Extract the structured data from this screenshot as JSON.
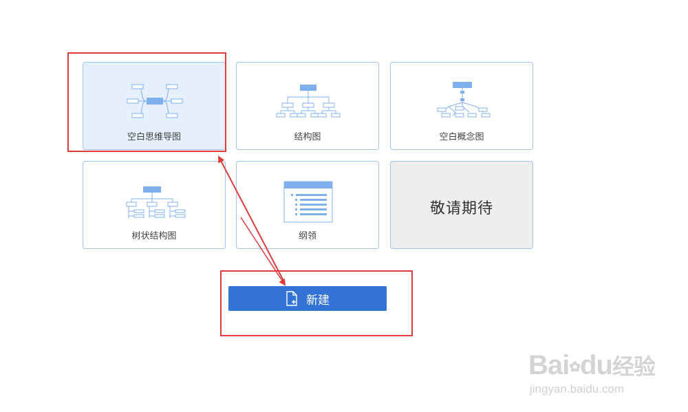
{
  "templates": [
    {
      "label": "空白思维导图",
      "icon": "mindmap-icon",
      "selected": true
    },
    {
      "label": "结构图",
      "icon": "org-chart-icon"
    },
    {
      "label": "空白概念图",
      "icon": "concept-map-icon"
    },
    {
      "label": "树状结构图",
      "icon": "tree-chart-icon"
    },
    {
      "label": "纲领",
      "icon": "outline-icon"
    },
    {
      "label": "敬请期待",
      "disabled": true
    }
  ],
  "new_button": {
    "label": "新建",
    "icon": "new-file-icon"
  },
  "colors": {
    "accent": "#3373d6",
    "card_border": "#9cc4ee",
    "selected_bg": "#e6f0fd",
    "annotation": "#e03a3a"
  },
  "watermark": {
    "logo": "Bai du 经验",
    "logo_brand": "Bai",
    "logo_brand_end": "du",
    "logo_suffix": "经验",
    "url": "jingyan.baidu.com"
  }
}
